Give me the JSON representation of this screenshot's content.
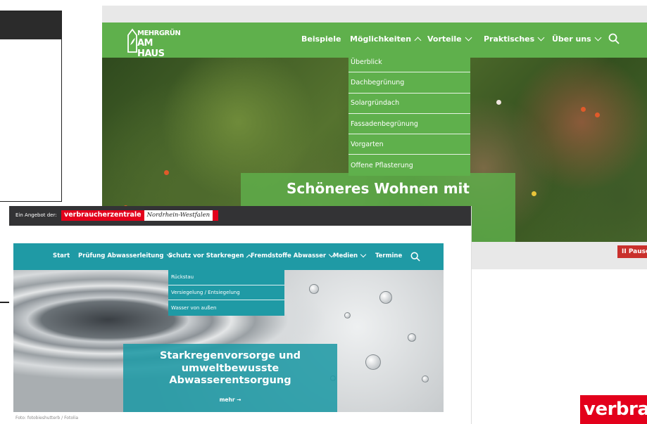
{
  "green_site": {
    "logo": {
      "line1": "MEHRGRÜN",
      "line2": "AM HAUS"
    },
    "nav": [
      {
        "label": "Beispiele",
        "has_chevron": false
      },
      {
        "label": "Möglichkeiten",
        "has_chevron": true,
        "open": true
      },
      {
        "label": "Vorteile",
        "has_chevron": true
      },
      {
        "label": "Praktisches",
        "has_chevron": true
      },
      {
        "label": "Über uns",
        "has_chevron": true
      }
    ],
    "search_icon": "search-icon",
    "dropdown": [
      "Überblick",
      "Dachbegrünung",
      "Solargründach",
      "Fassadenbegrünung",
      "Vorgarten",
      "Offene Pflasterung"
    ],
    "hero_title": "Schöneres Wohnen mit",
    "pause_label": "II Pause",
    "colors": {
      "brand_green": "#5fb04c",
      "pause_red": "#c9302c"
    }
  },
  "teal_site": {
    "offer_text": "Ein Angebot der:",
    "org_name": "verbraucherzentrale",
    "org_region": "Nordrhein-Westfalen",
    "nav": [
      {
        "label": "Start",
        "has_chevron": false
      },
      {
        "label": "Prüfung Abwasserleitung",
        "has_chevron": true
      },
      {
        "label": "Schutz vor Starkregen",
        "has_chevron": true,
        "open": true
      },
      {
        "label": "Fremdstoffe Abwasser",
        "has_chevron": true
      },
      {
        "label": "Medien",
        "has_chevron": true
      },
      {
        "label": "Termine",
        "has_chevron": false
      }
    ],
    "search_icon": "search-icon",
    "dropdown": [
      "Rückstau",
      "Versiegelung / Entsiegelung",
      "Wasser von außen"
    ],
    "hero_title": "Starkregenvorsorge und umweltbewusste Abwasserentsorgung",
    "more_label": "mehr →",
    "photo_credit": "Foto: fotobieshutterb / Fotolia",
    "colors": {
      "brand_teal": "#1f9aa5",
      "brand_red": "#e3001b"
    }
  },
  "corner_logo_text": "verbra"
}
